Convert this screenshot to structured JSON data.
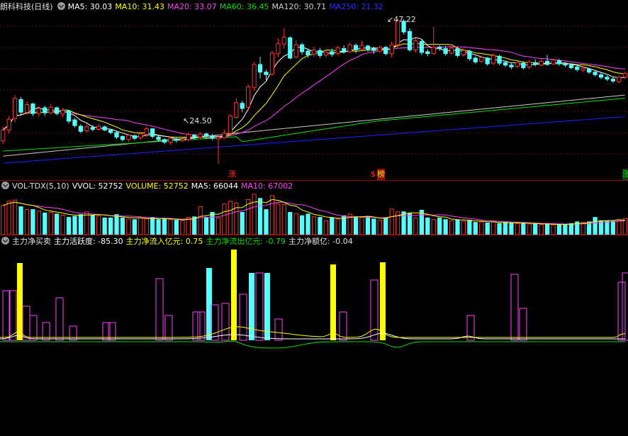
{
  "price_header": {
    "stock": "朗科科技(日线)",
    "ma5": "MA5: 30.03",
    "ma10": "MA10: 31.43",
    "ma20": "MA20: 33.07",
    "ma60": "MA60: 36.45",
    "ma120": "MA120: 30.71",
    "ma250": "MA250: 21.32"
  },
  "price_labels": {
    "high": "47.22",
    "low": "24.50"
  },
  "markers": {
    "zhang1": "涨",
    "bang": "榜",
    "dollar": "$",
    "right": "涨"
  },
  "vol_header": {
    "name": "VOL-TDX(5,10)",
    "vvol": "VVOL: 52752",
    "volume": "VOLUME: 52752",
    "ma5": "MA5: 66044",
    "ma10": "MA10: 67002"
  },
  "ind_header": {
    "name": "主力净买卖",
    "activity": "主力活跃度: -85.30",
    "inflow": "主力净流入亿元: 0.75",
    "outflow": "主力净流出亿元: -0.79",
    "net": "主力净额亿: -0.04"
  },
  "colors": {
    "up": "#ff3232",
    "down": "#54ffff",
    "ma5": "#ffffff",
    "ma10": "#ffff00",
    "ma20": "#ff40ff",
    "ma60": "#00e000",
    "ma120": "#c8c8c8",
    "ma250": "#2020ff"
  },
  "chart_data": {
    "type": "candlestick",
    "candles": [
      [
        28.1,
        29.8,
        27.6,
        30.3
      ],
      [
        29.8,
        31.5,
        29.2,
        32.0
      ],
      [
        31.6,
        34.8,
        31.0,
        35.3
      ],
      [
        34.6,
        32.6,
        32.1,
        35.0
      ],
      [
        32.6,
        33.8,
        32.2,
        34.3
      ],
      [
        33.9,
        32.4,
        32.0,
        34.1
      ],
      [
        32.4,
        33.2,
        31.9,
        33.5
      ],
      [
        33.3,
        32.5,
        32.0,
        33.6
      ],
      [
        32.5,
        33.4,
        32.2,
        33.9
      ],
      [
        33.3,
        32.4,
        32.1,
        33.5
      ],
      [
        32.3,
        32.9,
        31.8,
        33.3
      ],
      [
        32.8,
        31.2,
        30.8,
        32.9
      ],
      [
        31.4,
        30.5,
        30.2,
        31.7
      ],
      [
        30.4,
        29.6,
        29.3,
        30.7
      ],
      [
        29.7,
        30.3,
        29.4,
        30.7
      ],
      [
        30.2,
        29.9,
        29.6,
        30.6
      ],
      [
        29.9,
        30.4,
        29.7,
        30.8
      ],
      [
        30.3,
        29.8,
        29.6,
        30.5
      ],
      [
        29.8,
        29.4,
        29.1,
        30.0
      ],
      [
        29.4,
        28.7,
        28.4,
        29.6
      ],
      [
        28.8,
        28.3,
        28.0,
        29.0
      ],
      [
        28.3,
        29.0,
        27.9,
        29.2
      ],
      [
        28.9,
        28.5,
        28.2,
        29.1
      ],
      [
        28.6,
        29.2,
        28.3,
        29.5
      ],
      [
        29.1,
        30.0,
        28.7,
        30.3
      ],
      [
        30.0,
        28.8,
        28.5,
        30.1
      ],
      [
        28.7,
        28.3,
        28.0,
        28.9
      ],
      [
        28.3,
        27.9,
        27.6,
        28.5
      ],
      [
        27.9,
        28.5,
        27.5,
        28.8
      ],
      [
        28.4,
        28.2,
        27.8,
        28.6
      ],
      [
        28.1,
        28.3,
        27.9,
        28.5
      ],
      [
        28.3,
        29.1,
        28.0,
        29.4
      ],
      [
        29.0,
        28.7,
        28.3,
        29.2
      ],
      [
        28.7,
        29.2,
        28.3,
        29.5
      ],
      [
        29.2,
        28.8,
        28.5,
        29.4
      ],
      [
        28.9,
        28.5,
        28.2,
        29.2
      ],
      [
        28.4,
        28.7,
        24.5,
        29.0
      ],
      [
        28.6,
        29.3,
        28.4,
        29.9
      ],
      [
        29.3,
        32.0,
        29.0,
        32.3
      ],
      [
        31.8,
        34.1,
        31.6,
        34.8
      ],
      [
        34.0,
        33.2,
        32.6,
        34.4
      ],
      [
        33.4,
        36.6,
        33.0,
        37.0
      ],
      [
        36.5,
        40.1,
        36.0,
        40.5
      ],
      [
        40.1,
        38.9,
        37.9,
        41.3
      ],
      [
        38.9,
        38.5,
        37.6,
        39.3
      ],
      [
        38.6,
        41.9,
        38.3,
        42.3
      ],
      [
        41.8,
        43.4,
        41.3,
        44.2
      ],
      [
        43.3,
        44.4,
        42.6,
        45.8
      ],
      [
        44.3,
        41.1,
        40.9,
        44.5
      ],
      [
        41.3,
        43.2,
        41.0,
        43.9
      ],
      [
        43.2,
        42.1,
        41.6,
        43.5
      ],
      [
        42.2,
        41.6,
        41.2,
        42.6
      ],
      [
        41.7,
        42.4,
        41.3,
        42.9
      ],
      [
        42.3,
        41.5,
        41.1,
        42.7
      ],
      [
        41.6,
        42.0,
        41.2,
        42.4
      ],
      [
        42.1,
        41.7,
        41.3,
        42.6
      ],
      [
        41.8,
        42.7,
        41.5,
        43.1
      ],
      [
        42.6,
        42.1,
        41.8,
        43.1
      ],
      [
        42.1,
        43.2,
        41.9,
        43.6
      ],
      [
        43.1,
        42.4,
        41.9,
        43.4
      ],
      [
        42.5,
        43.1,
        42.2,
        43.8
      ],
      [
        43.0,
        42.5,
        42.1,
        43.2
      ],
      [
        42.6,
        42.3,
        41.8,
        42.9
      ],
      [
        42.2,
        42.8,
        41.9,
        43.1
      ],
      [
        42.8,
        41.8,
        41.5,
        43.0
      ],
      [
        41.8,
        43.2,
        41.2,
        43.7
      ],
      [
        43.2,
        47.0,
        42.8,
        47.2
      ],
      [
        46.9,
        45.2,
        44.8,
        47.2
      ],
      [
        45.3,
        42.4,
        42.1,
        45.8
      ],
      [
        42.4,
        43.8,
        42.0,
        44.3
      ],
      [
        43.7,
        42.0,
        41.6,
        44.1
      ],
      [
        42.1,
        41.8,
        41.4,
        42.5
      ],
      [
        41.8,
        42.8,
        41.6,
        46.0
      ],
      [
        42.8,
        42.6,
        42.2,
        43.1
      ],
      [
        42.6,
        41.8,
        41.5,
        43.0
      ],
      [
        41.9,
        42.7,
        41.6,
        43.0
      ],
      [
        42.6,
        41.5,
        41.2,
        42.9
      ],
      [
        41.6,
        42.3,
        41.3,
        42.6
      ],
      [
        42.2,
        41.0,
        40.7,
        42.4
      ],
      [
        41.1,
        40.5,
        40.2,
        41.4
      ],
      [
        40.6,
        41.2,
        40.3,
        41.5
      ],
      [
        41.1,
        40.2,
        39.9,
        41.3
      ],
      [
        40.3,
        41.5,
        40.0,
        41.9
      ],
      [
        41.4,
        40.3,
        40.0,
        41.6
      ],
      [
        40.4,
        40.0,
        39.7,
        40.7
      ],
      [
        40.0,
        39.7,
        39.4,
        40.3
      ],
      [
        39.8,
        40.4,
        39.5,
        40.7
      ],
      [
        40.3,
        39.6,
        39.3,
        40.6
      ],
      [
        39.7,
        40.5,
        39.4,
        40.8
      ],
      [
        40.4,
        40.1,
        39.8,
        40.9
      ],
      [
        40.0,
        40.6,
        39.8,
        41.0
      ],
      [
        40.6,
        40.1,
        39.9,
        41.6
      ],
      [
        40.2,
        40.8,
        40.0,
        41.0
      ],
      [
        40.7,
        40.2,
        39.9,
        41.0
      ],
      [
        40.2,
        40.0,
        39.7,
        40.5
      ],
      [
        40.0,
        39.6,
        39.3,
        40.3
      ],
      [
        39.7,
        39.3,
        39.0,
        40.0
      ],
      [
        39.2,
        39.5,
        38.9,
        39.8
      ],
      [
        39.4,
        38.9,
        38.6,
        39.6
      ],
      [
        38.9,
        38.5,
        38.2,
        39.2
      ],
      [
        38.5,
        38.1,
        37.8,
        38.8
      ],
      [
        38.1,
        37.8,
        37.5,
        38.4
      ],
      [
        37.8,
        37.5,
        37.2,
        38.1
      ],
      [
        37.4,
        38.1,
        37.1,
        38.4
      ],
      [
        38.1,
        38.7,
        37.8,
        39.0
      ]
    ],
    "volumes": [
      10.5,
      12.0,
      12.4,
      10.0,
      9.0,
      9.0,
      8.4,
      7.8,
      8.0,
      7.4,
      7.0,
      6.2,
      6.6,
      7.2,
      8.2,
      7.0,
      6.8,
      6.0,
      6.0,
      7.2,
      6.0,
      5.6,
      5.4,
      6.0,
      5.8,
      6.2,
      5.4,
      5.6,
      5.4,
      5.2,
      5.0,
      6.2,
      6.4,
      10.0,
      6.2,
      8.0,
      6.0,
      11.0,
      12.0,
      11.4,
      8.0,
      12.6,
      14.5,
      13.0,
      9.0,
      14.0,
      11.0,
      10.8,
      8.0,
      7.6,
      6.8,
      7.4,
      6.4,
      6.2,
      5.0,
      6.0,
      5.6,
      6.8,
      7.4,
      6.2,
      6.2,
      6.4,
      5.6,
      5.2,
      6.0,
      9.2,
      8.2,
      8.2,
      7.6,
      6.0,
      8.8,
      6.0,
      5.4,
      6.0,
      5.4,
      5.0,
      5.2,
      4.8,
      5.2,
      4.4,
      4.6,
      4.2,
      4.6,
      4.0,
      4.4,
      4.2,
      4.0,
      4.2,
      3.8,
      3.8,
      3.6,
      3.8,
      3.6,
      3.6,
      3.8,
      4.0,
      4.6,
      4.4,
      4.6,
      6.2,
      5.0,
      5.0,
      4.8,
      5.4,
      5.8
    ]
  }
}
